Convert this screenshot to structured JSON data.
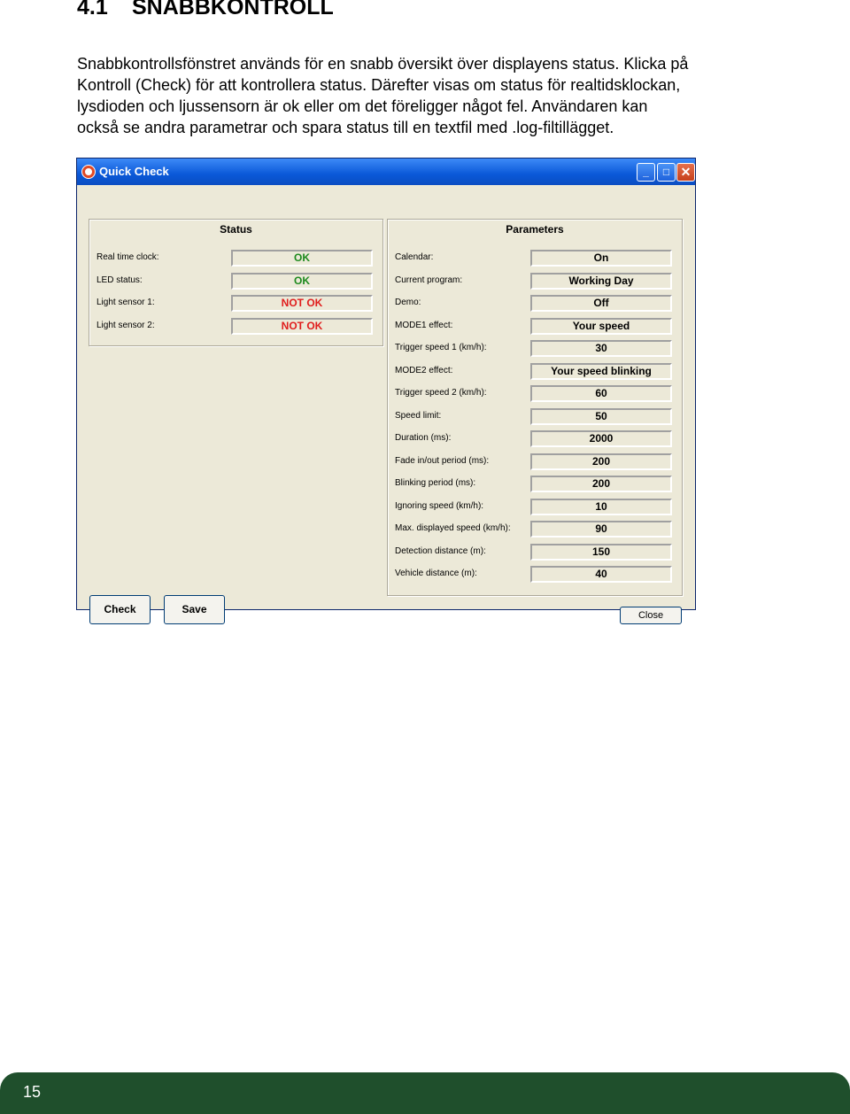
{
  "heading": {
    "number": "4.1",
    "title": "SNABBKONTROLL"
  },
  "intro": {
    "lines": [
      "Snabbkontrollsfönstret används för en snabb översikt över displayens status. Klicka på",
      "Kontroll (Check) för att kontrollera status. Därefter visas om status för realtidsklockan,",
      "lysdioden och ljussensorn är ok eller om det föreligger något fel. Användaren kan",
      "också se andra parametrar och spara status till en textfil med .log-filtillägget."
    ]
  },
  "window": {
    "title": "Quick Check",
    "controls": {
      "minimize": "_",
      "maximize": "□",
      "close": "✕"
    },
    "status": {
      "title": "Status",
      "rows": [
        {
          "label": "Real time clock:",
          "value": "OK",
          "state": "ok"
        },
        {
          "label": "LED status:",
          "value": "OK",
          "state": "ok"
        },
        {
          "label": "Light sensor 1:",
          "value": "NOT OK",
          "state": "bad"
        },
        {
          "label": "Light sensor 2:",
          "value": "NOT OK",
          "state": "bad"
        }
      ]
    },
    "parameters": {
      "title": "Parameters",
      "rows": [
        {
          "label": "Calendar:",
          "value": "On"
        },
        {
          "label": "Current program:",
          "value": "Working Day"
        },
        {
          "label": "Demo:",
          "value": "Off"
        },
        {
          "label": "MODE1 effect:",
          "value": "Your speed"
        },
        {
          "label": "Trigger speed 1 (km/h):",
          "value": "30"
        },
        {
          "label": "MODE2 effect:",
          "value": "Your speed blinking"
        },
        {
          "label": "Trigger speed 2 (km/h):",
          "value": "60"
        },
        {
          "label": "Speed limit:",
          "value": "50"
        },
        {
          "label": "Duration (ms):",
          "value": "2000"
        },
        {
          "label": "Fade in/out period (ms):",
          "value": "200"
        },
        {
          "label": "Blinking period (ms):",
          "value": "200"
        },
        {
          "label": "Ignoring speed (km/h):",
          "value": "10"
        },
        {
          "label": "Max. displayed speed (km/h):",
          "value": "90"
        },
        {
          "label": "Detection distance (m):",
          "value": "150"
        },
        {
          "label": "Vehicle distance (m):",
          "value": "40"
        }
      ]
    },
    "buttons": {
      "check": "Check",
      "save": "Save",
      "close": "Close"
    }
  },
  "footer": {
    "page_number": "15"
  },
  "colors": {
    "ok": "#1d8a1d",
    "bad": "#e01d1d",
    "footer": "#1f4f2c",
    "titlebar": "#0a58d8"
  }
}
